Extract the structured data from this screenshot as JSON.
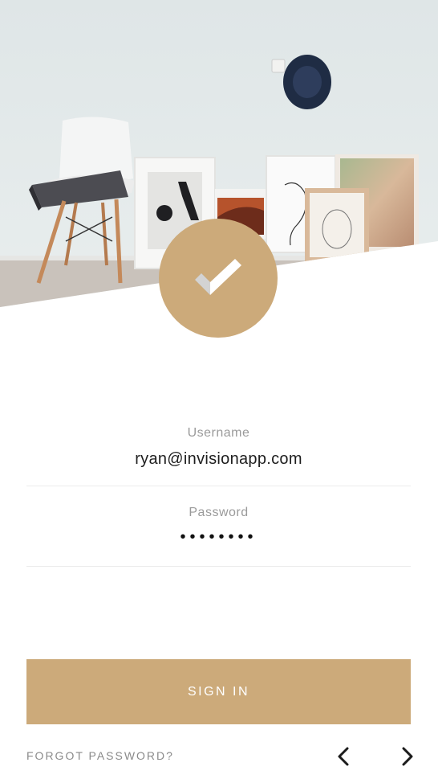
{
  "login": {
    "username_label": "Username",
    "username_value": "ryan@invisionapp.com",
    "password_label": "Password",
    "password_value": "••••••••"
  },
  "actions": {
    "sign_in_label": "SIGN IN",
    "forgot_password_label": "FORGOT PASSWORD?"
  },
  "icons": {
    "badge": "checkmark-icon",
    "back": "chevron-left-icon",
    "forward": "chevron-right-icon"
  },
  "colors": {
    "accent": "#ccaa7a",
    "button_text": "#ffffff",
    "label_gray": "#9a9a9a"
  }
}
